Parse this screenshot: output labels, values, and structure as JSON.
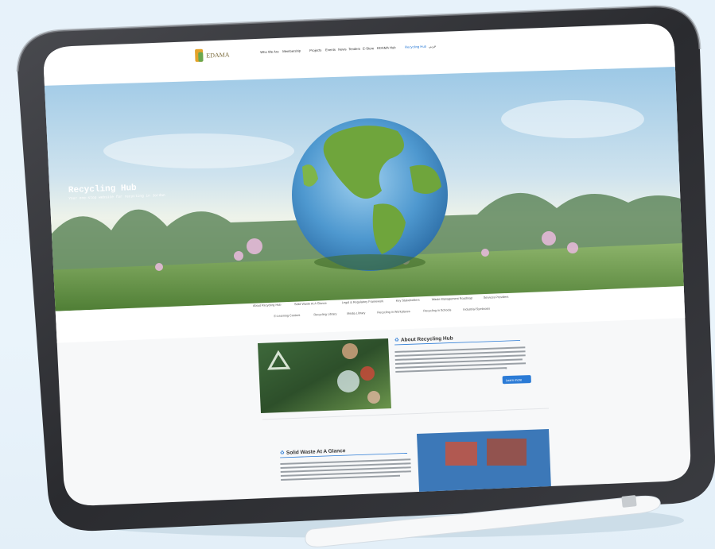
{
  "site": {
    "brand": "EDAMA",
    "nav": [
      "Who We Are",
      "Membership",
      "Projects",
      "Events",
      "News",
      "Tenders",
      "E-Store",
      "EDAMA Hub",
      "Recycling Hub",
      "عربي"
    ]
  },
  "hero": {
    "title": "Recycling Hub",
    "subtitle": "Your one-stop website for recycling in Jordan"
  },
  "sub_nav": {
    "row1": [
      "About Recycling Hub",
      "Solid Waste At A Glance",
      "Legal & Regulatory Framework",
      "Key Stakeholders",
      "Waste Management Roadmap",
      "Services Providers"
    ],
    "row2": [
      "E-Learning Content",
      "Recycling Library",
      "Media Library",
      "Recycling in Workplaces",
      "Recycling in Schools",
      "Industrial Symbiosis"
    ]
  },
  "about": {
    "heading": "About Recycling Hub",
    "button": "Learn more"
  },
  "glance": {
    "heading": "Solid Waste At A Glance"
  },
  "colors": {
    "accent": "#2b7bd6",
    "device_frame": "#2e2f33",
    "background": "#e7f2fa"
  }
}
